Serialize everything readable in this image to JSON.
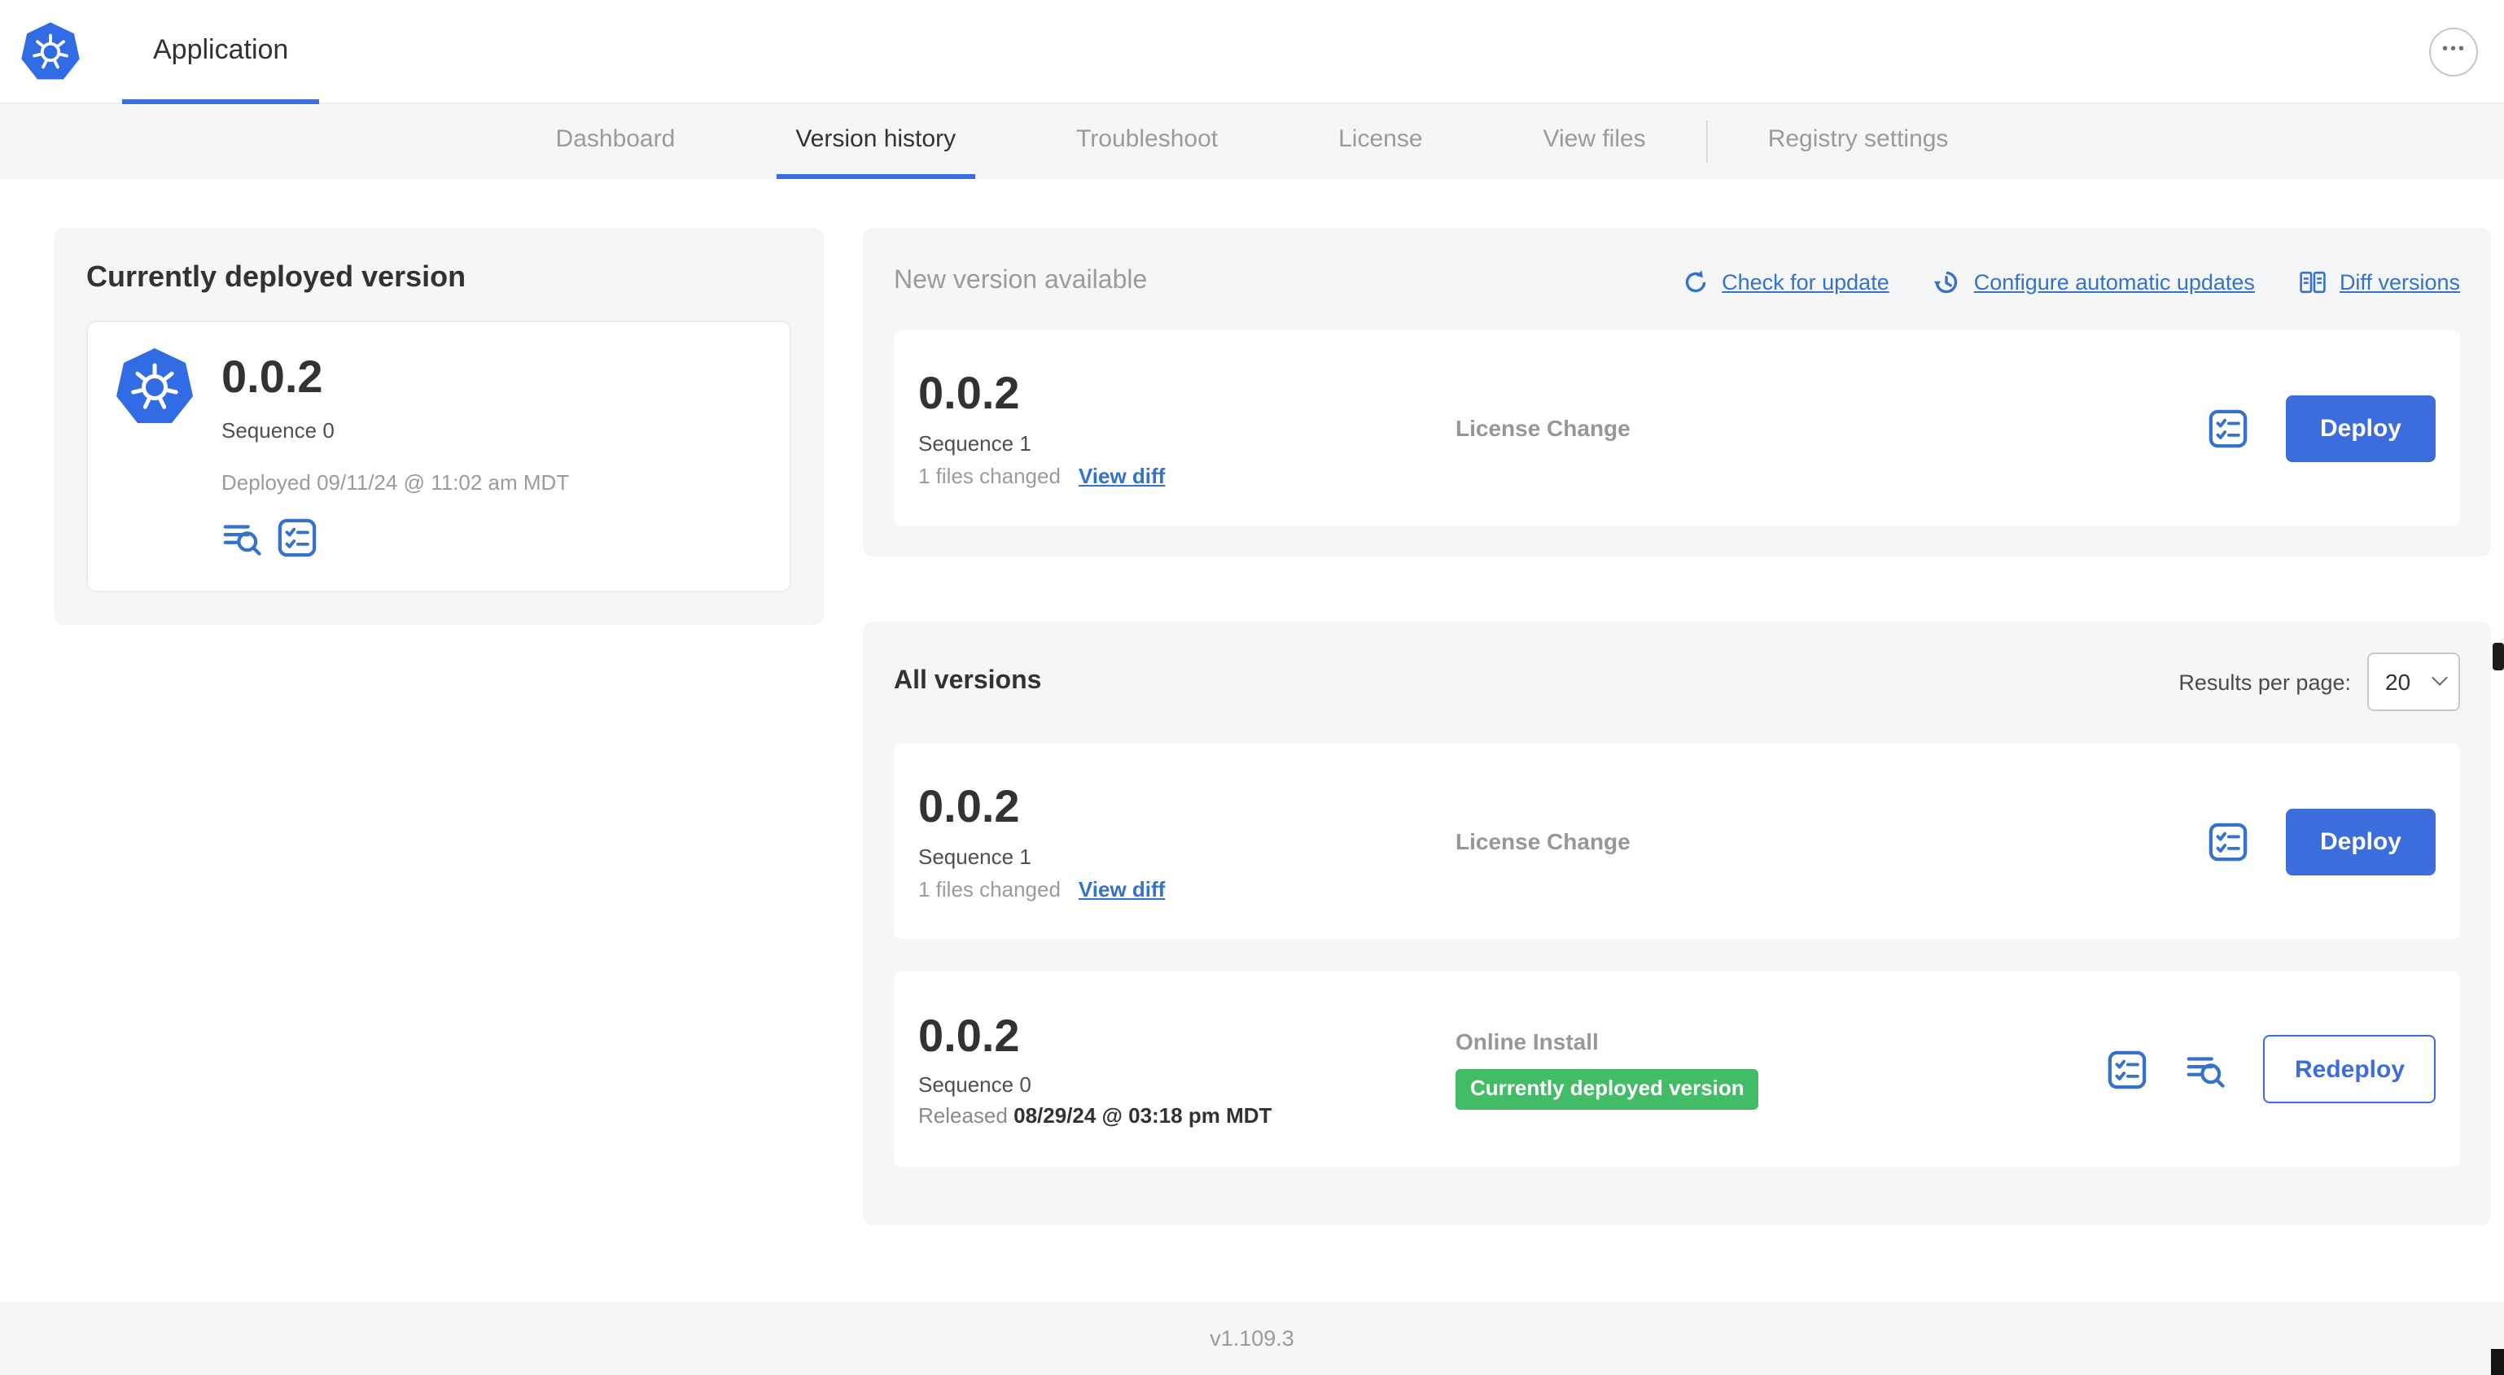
{
  "header": {
    "app_name": "Application",
    "more_icon": "•••"
  },
  "nav": {
    "tabs": [
      {
        "label": "Dashboard",
        "active": false
      },
      {
        "label": "Version history",
        "active": true
      },
      {
        "label": "Troubleshoot",
        "active": false
      },
      {
        "label": "License",
        "active": false
      },
      {
        "label": "View files",
        "active": false
      },
      {
        "label": "Registry settings",
        "active": false
      }
    ]
  },
  "deployed_card": {
    "title": "Currently deployed version",
    "version": "0.0.2",
    "sequence": "Sequence 0",
    "deployed_at": "Deployed 09/11/24 @ 11:02 am MDT"
  },
  "new_version": {
    "title": "New version available",
    "actions": {
      "check_for_update": "Check for update",
      "configure_automatic_updates": "Configure automatic updates",
      "diff_versions": "Diff versions"
    },
    "row": {
      "version": "0.0.2",
      "sequence": "Sequence 1",
      "files_changed": "1 files changed",
      "view_diff": "View diff",
      "source": "License Change",
      "action_label": "Deploy"
    }
  },
  "all_versions": {
    "title": "All versions",
    "results_per_page_label": "Results per page:",
    "results_per_page_value": "20",
    "rows": [
      {
        "version": "0.0.2",
        "sequence": "Sequence 1",
        "files_changed": "1 files changed",
        "view_diff": "View diff",
        "source": "License Change",
        "action_label": "Deploy"
      },
      {
        "version": "0.0.2",
        "sequence": "Sequence 0",
        "released_label": "Released",
        "released_value": "08/29/24 @ 03:18 pm MDT",
        "source": "Online Install",
        "badge": "Currently deployed version",
        "action_label": "Redeploy"
      }
    ]
  },
  "footer": {
    "app_version": "v1.109.3"
  },
  "colors": {
    "accent_blue": "#3b6ddc",
    "link_blue": "#3572cb",
    "badge_green": "#44bb66",
    "muted_text": "#9b9b9b",
    "dark_text": "#323232",
    "panel_bg": "#f5f6f8"
  }
}
